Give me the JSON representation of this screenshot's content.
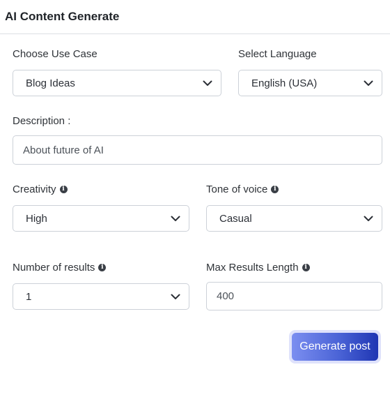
{
  "header": {
    "title": "AI Content Generate"
  },
  "form": {
    "use_case": {
      "label": "Choose Use Case",
      "value": "Blog Ideas"
    },
    "language": {
      "label": "Select Language",
      "value": "English (USA)"
    },
    "description": {
      "label": "Description :",
      "value": "About future of AI"
    },
    "creativity": {
      "label": "Creativity",
      "value": "High",
      "info_icon": "info-icon"
    },
    "tone": {
      "label": "Tone of voice",
      "value": "Casual",
      "info_icon": "info-icon"
    },
    "num_results": {
      "label": "Number of results",
      "value": "1",
      "info_icon": "info-icon"
    },
    "max_length": {
      "label": "Max Results Length",
      "value": "400",
      "info_icon": "info-icon"
    }
  },
  "actions": {
    "generate_label": "Generate post"
  },
  "colors": {
    "button_gradient_start": "#7b8ef0",
    "button_gradient_end": "#1f36b3",
    "button_ring": "#dfe2fb"
  }
}
